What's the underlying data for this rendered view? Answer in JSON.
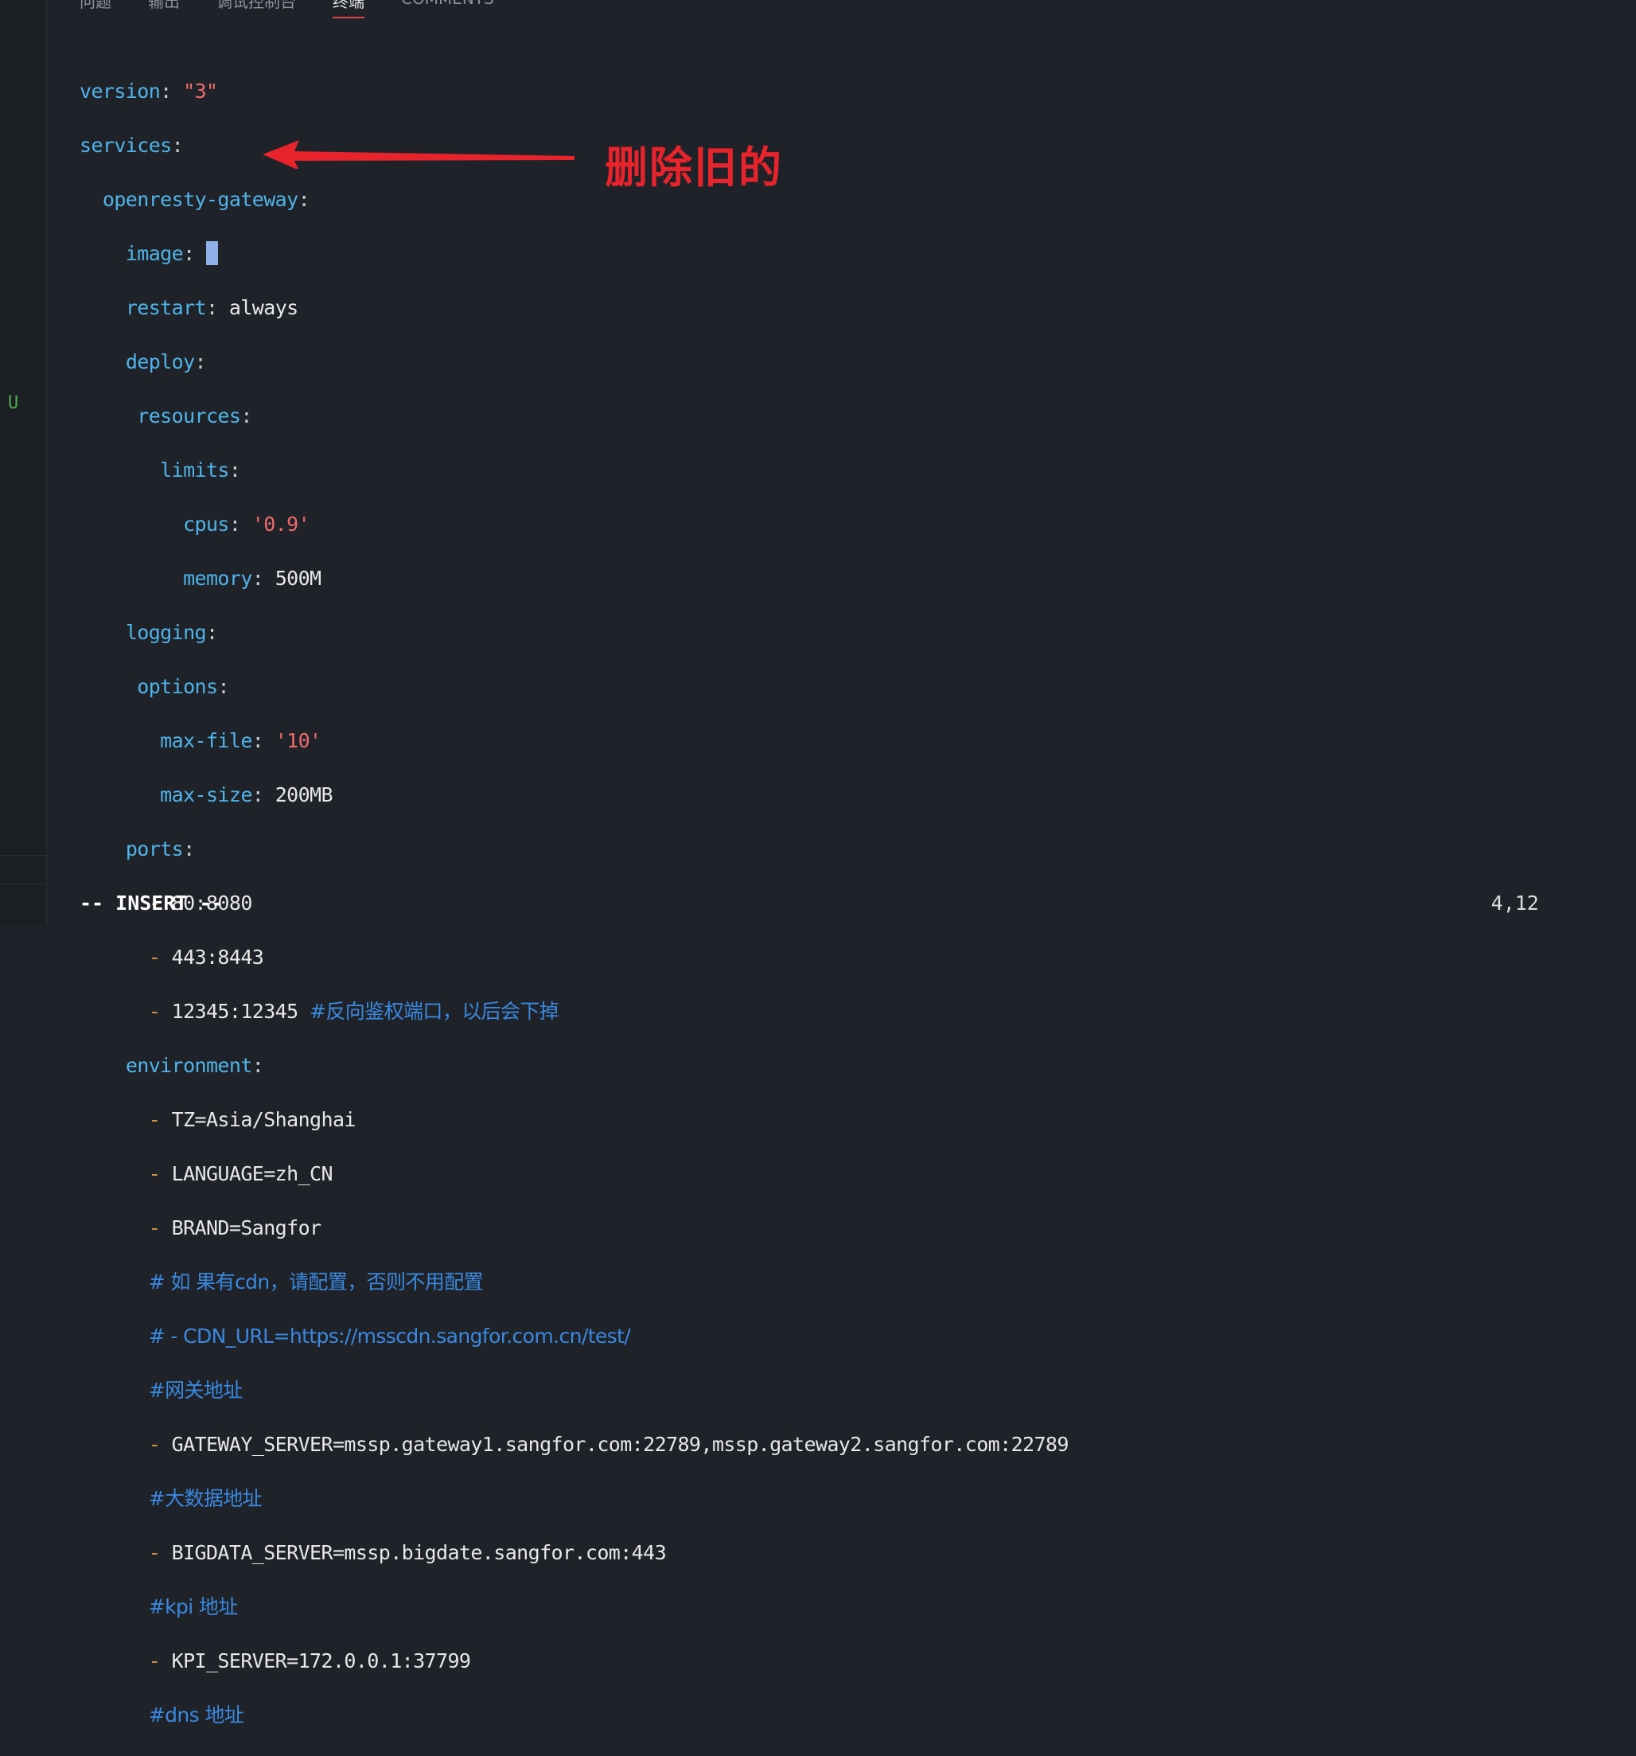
{
  "tabs": [
    "问题",
    "输出",
    "调试控制台",
    "终端",
    "COMMENTS"
  ],
  "active_tab": "终端",
  "gutter_marker": "U",
  "annotation": "删除旧的",
  "status": {
    "mode": "-- INSERT --",
    "cursor_pos": "4,12"
  },
  "yaml": {
    "version_key": "version",
    "version_val": "\"3\"",
    "services_key": "services",
    "svc_name": "openresty-gateway",
    "image_key": "image",
    "restart_key": "restart",
    "restart_val": "always",
    "deploy_key": "deploy",
    "resources_key": "resources",
    "limits_key": "limits",
    "cpus_key": "cpus",
    "cpus_val": "'0.9'",
    "memory_key": "memory",
    "memory_val": "500M",
    "logging_key": "logging",
    "options_key": "options",
    "maxfile_key": "max-file",
    "maxfile_val": "'10'",
    "maxsize_key": "max-size",
    "maxsize_val": "200MB",
    "ports_key": "ports",
    "ports": [
      "80:8080",
      "443:8443",
      "12345:12345"
    ],
    "port_comment": "#反向鉴权端口，以后会下掉",
    "env_key": "environment",
    "env": [
      "TZ=Asia/Shanghai",
      "LANGUAGE=zh_CN",
      "BRAND=Sangfor"
    ],
    "cdn_comment": "# 如 果有cdn，请配置，否则不用配置",
    "cdn_url_comment": "# - CDN_URL=https://msscdn.sangfor.com.cn/test/",
    "gateway_comment": "#网关地址",
    "gateway_val": "GATEWAY_SERVER=mssp.gateway1.sangfor.com:22789,mssp.gateway2.sangfor.com:22789",
    "bigdata_comment": "#大数据地址",
    "bigdata_val": "BIGDATA_SERVER=mssp.bigdate.sangfor.com:443",
    "kpi_comment": "#kpi 地址",
    "kpi_val": "KPI_SERVER=172.0.0.1:37799",
    "dns_comment": "#dns 地址"
  }
}
